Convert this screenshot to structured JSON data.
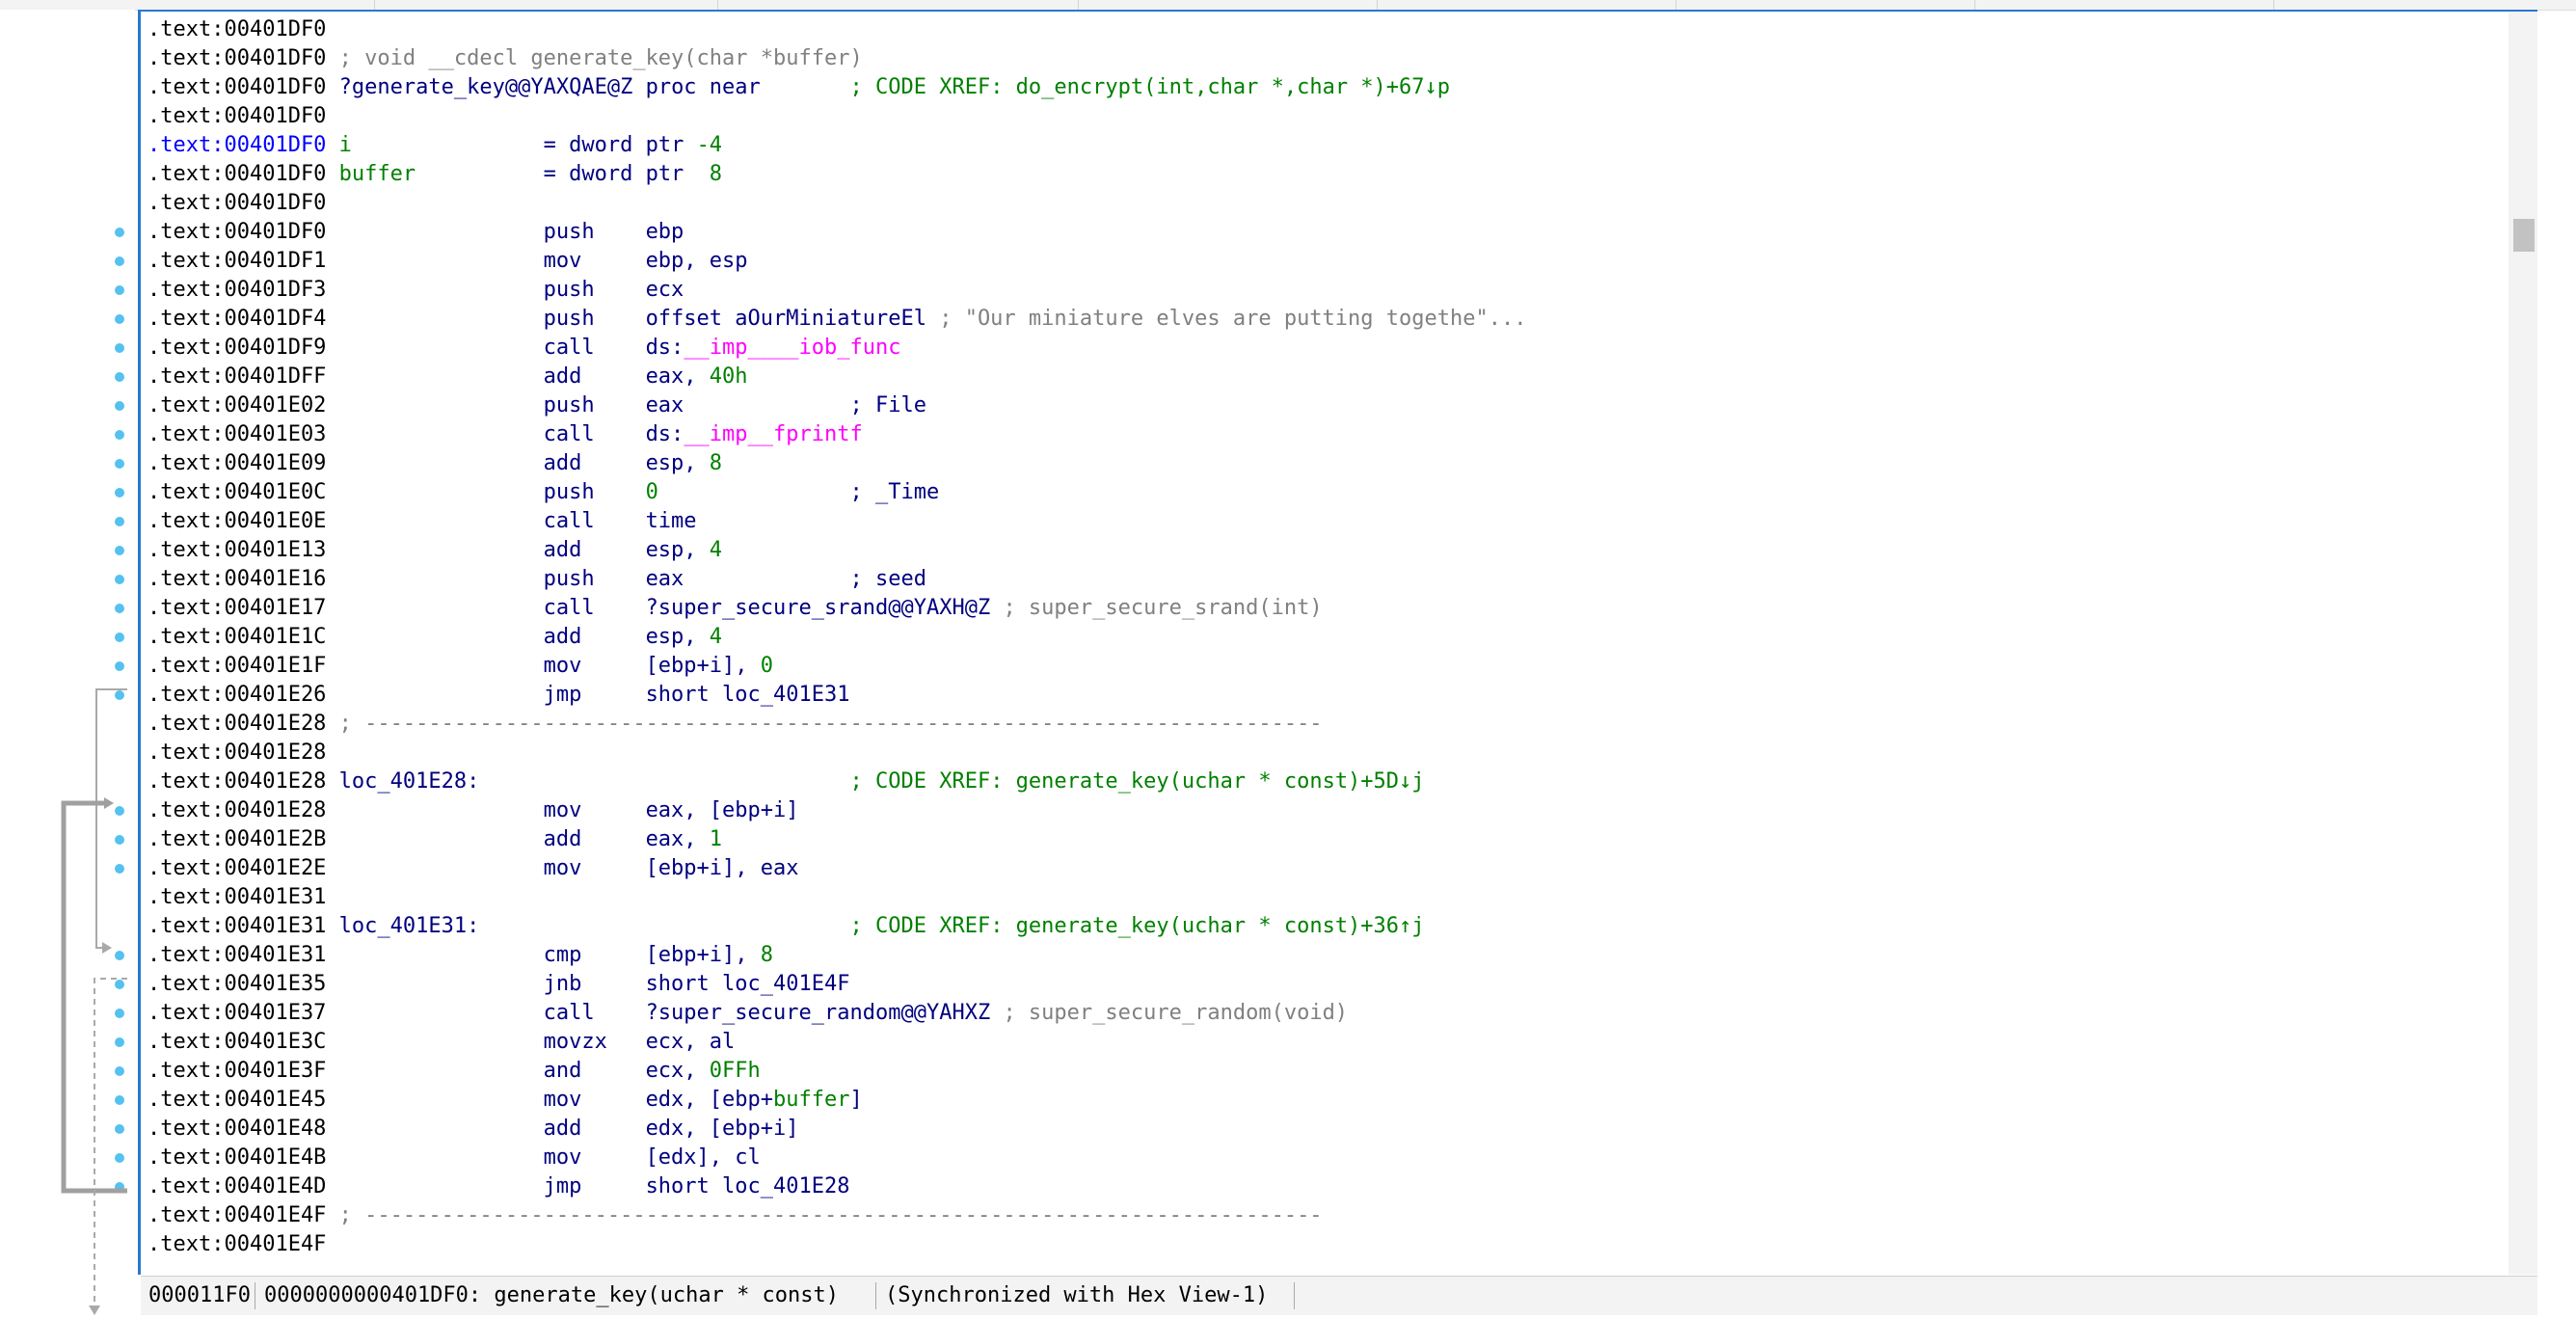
{
  "colors": {
    "address": "#000000",
    "instruction": "#000080",
    "number": "#008000",
    "comment": "#808080",
    "xref": "#008000",
    "import": "#ff00ff",
    "selection_border": "#2a78d4",
    "flow_dot": "#55c1f0"
  },
  "listing": [
    {
      "addr": ".text:00401DF0",
      "parts": []
    },
    {
      "addr": ".text:00401DF0",
      "parts": [
        {
          "t": " ; void __cdecl generate_key(char *buffer)",
          "c": "cmt"
        }
      ]
    },
    {
      "addr": ".text:00401DF0",
      "parts": [
        {
          "t": " ?generate_key@@YAXQAE@Z",
          "c": "name"
        },
        {
          "t": " proc near       ",
          "c": "mnem"
        },
        {
          "t": "; CODE XREF: do_encrypt(int,char *,char *)+67↓p",
          "c": "xref"
        }
      ]
    },
    {
      "addr": ".text:00401DF0",
      "parts": []
    },
    {
      "addr": ".text:00401DF0",
      "selected": true,
      "parts": [
        {
          "t": " i",
          "c": "stack"
        },
        {
          "t": "               = dword ptr ",
          "c": "op"
        },
        {
          "t": "-4",
          "c": "num"
        }
      ]
    },
    {
      "addr": ".text:00401DF0",
      "parts": [
        {
          "t": " buffer",
          "c": "stack"
        },
        {
          "t": "          = dword ptr  ",
          "c": "op"
        },
        {
          "t": "8",
          "c": "num"
        }
      ]
    },
    {
      "addr": ".text:00401DF0",
      "parts": []
    },
    {
      "addr": ".text:00401DF0",
      "parts": [
        {
          "t": "                 push    ebp",
          "c": "mnem"
        }
      ]
    },
    {
      "addr": ".text:00401DF1",
      "parts": [
        {
          "t": "                 mov     ebp, esp",
          "c": "mnem"
        }
      ]
    },
    {
      "addr": ".text:00401DF3",
      "parts": [
        {
          "t": "                 push    ecx",
          "c": "mnem"
        }
      ]
    },
    {
      "addr": ".text:00401DF4",
      "parts": [
        {
          "t": "                 push    offset aOurMiniatureEl ",
          "c": "mnem"
        },
        {
          "t": "; \"Our miniature elves are putting togethe\"...",
          "c": "cmt"
        }
      ]
    },
    {
      "addr": ".text:00401DF9",
      "parts": [
        {
          "t": "                 call    ds:",
          "c": "mnem"
        },
        {
          "t": "__imp____iob_func",
          "c": "imp"
        }
      ]
    },
    {
      "addr": ".text:00401DFF",
      "parts": [
        {
          "t": "                 add     eax, ",
          "c": "mnem"
        },
        {
          "t": "40h",
          "c": "num"
        }
      ]
    },
    {
      "addr": ".text:00401E02",
      "parts": [
        {
          "t": "                 push    eax             ",
          "c": "mnem"
        },
        {
          "t": "; File",
          "c": "mnem"
        }
      ]
    },
    {
      "addr": ".text:00401E03",
      "parts": [
        {
          "t": "                 call    ds:",
          "c": "mnem"
        },
        {
          "t": "__imp__fprintf",
          "c": "imp"
        }
      ]
    },
    {
      "addr": ".text:00401E09",
      "parts": [
        {
          "t": "                 add     esp, ",
          "c": "mnem"
        },
        {
          "t": "8",
          "c": "num"
        }
      ]
    },
    {
      "addr": ".text:00401E0C",
      "parts": [
        {
          "t": "                 push    ",
          "c": "mnem"
        },
        {
          "t": "0",
          "c": "num"
        },
        {
          "t": "               ; _Time",
          "c": "mnem"
        }
      ]
    },
    {
      "addr": ".text:00401E0E",
      "parts": [
        {
          "t": "                 call    time",
          "c": "mnem"
        }
      ]
    },
    {
      "addr": ".text:00401E13",
      "parts": [
        {
          "t": "                 add     esp, ",
          "c": "mnem"
        },
        {
          "t": "4",
          "c": "num"
        }
      ]
    },
    {
      "addr": ".text:00401E16",
      "parts": [
        {
          "t": "                 push    eax             ",
          "c": "mnem"
        },
        {
          "t": "; seed",
          "c": "mnem"
        }
      ]
    },
    {
      "addr": ".text:00401E17",
      "parts": [
        {
          "t": "                 call    ?super_secure_srand@@YAXH@Z ",
          "c": "mnem"
        },
        {
          "t": "; super_secure_srand(int)",
          "c": "cmt"
        }
      ]
    },
    {
      "addr": ".text:00401E1C",
      "parts": [
        {
          "t": "                 add     esp, ",
          "c": "mnem"
        },
        {
          "t": "4",
          "c": "num"
        }
      ]
    },
    {
      "addr": ".text:00401E1F",
      "parts": [
        {
          "t": "                 mov     [ebp+i], ",
          "c": "mnem"
        },
        {
          "t": "0",
          "c": "num"
        }
      ]
    },
    {
      "addr": ".text:00401E26",
      "parts": [
        {
          "t": "                 jmp     short loc_401E31",
          "c": "mnem"
        }
      ]
    },
    {
      "addr": ".text:00401E28",
      "parts": [
        {
          "t": " ; ---------------------------------------------------------------------------",
          "c": "cmt"
        }
      ]
    },
    {
      "addr": ".text:00401E28",
      "parts": []
    },
    {
      "addr": ".text:00401E28",
      "parts": [
        {
          "t": " loc_401E28:",
          "c": "name"
        },
        {
          "t": "                             ",
          "c": "mnem"
        },
        {
          "t": "; CODE XREF: generate_key(uchar * const)+5D↓j",
          "c": "xref"
        }
      ]
    },
    {
      "addr": ".text:00401E28",
      "parts": [
        {
          "t": "                 mov     eax, [ebp+i]",
          "c": "mnem"
        }
      ]
    },
    {
      "addr": ".text:00401E2B",
      "parts": [
        {
          "t": "                 add     eax, ",
          "c": "mnem"
        },
        {
          "t": "1",
          "c": "num"
        }
      ]
    },
    {
      "addr": ".text:00401E2E",
      "parts": [
        {
          "t": "                 mov     [ebp+i], eax",
          "c": "mnem"
        }
      ]
    },
    {
      "addr": ".text:00401E31",
      "parts": []
    },
    {
      "addr": ".text:00401E31",
      "parts": [
        {
          "t": " loc_401E31:",
          "c": "name"
        },
        {
          "t": "                             ",
          "c": "mnem"
        },
        {
          "t": "; CODE XREF: generate_key(uchar * const)+36↑j",
          "c": "xref"
        }
      ]
    },
    {
      "addr": ".text:00401E31",
      "parts": [
        {
          "t": "                 cmp     [ebp+i], ",
          "c": "mnem"
        },
        {
          "t": "8",
          "c": "num"
        }
      ]
    },
    {
      "addr": ".text:00401E35",
      "parts": [
        {
          "t": "                 jnb     short loc_401E4F",
          "c": "mnem"
        }
      ]
    },
    {
      "addr": ".text:00401E37",
      "parts": [
        {
          "t": "                 call    ?super_secure_random@@YAHXZ ",
          "c": "mnem"
        },
        {
          "t": "; super_secure_random(void)",
          "c": "cmt"
        }
      ]
    },
    {
      "addr": ".text:00401E3C",
      "parts": [
        {
          "t": "                 movzx   ecx, al",
          "c": "mnem"
        }
      ]
    },
    {
      "addr": ".text:00401E3F",
      "parts": [
        {
          "t": "                 and     ecx, ",
          "c": "mnem"
        },
        {
          "t": "0FFh",
          "c": "num"
        }
      ]
    },
    {
      "addr": ".text:00401E45",
      "parts": [
        {
          "t": "                 mov     edx, [ebp+",
          "c": "mnem"
        },
        {
          "t": "buffer",
          "c": "stack"
        },
        {
          "t": "]",
          "c": "mnem"
        }
      ]
    },
    {
      "addr": ".text:00401E48",
      "parts": [
        {
          "t": "                 add     edx, [ebp+i]",
          "c": "mnem"
        }
      ]
    },
    {
      "addr": ".text:00401E4B",
      "parts": [
        {
          "t": "                 mov     [edx], cl",
          "c": "mnem"
        }
      ]
    },
    {
      "addr": ".text:00401E4D",
      "parts": [
        {
          "t": "                 jmp     short loc_401E28",
          "c": "mnem"
        }
      ]
    },
    {
      "addr": ".text:00401E4F",
      "parts": [
        {
          "t": " ; ---------------------------------------------------------------------------",
          "c": "cmt"
        }
      ]
    },
    {
      "addr": ".text:00401E4F",
      "parts": []
    }
  ],
  "statusbar": {
    "offset": "000011F0",
    "location": "0000000000401DF0: generate_key(uchar * const)",
    "sync": "(Synchronized with Hex View-1)"
  },
  "icons": {
    "flow_dot": "breakpoint-dot-icon",
    "arrow": "flow-arrow-icon"
  }
}
